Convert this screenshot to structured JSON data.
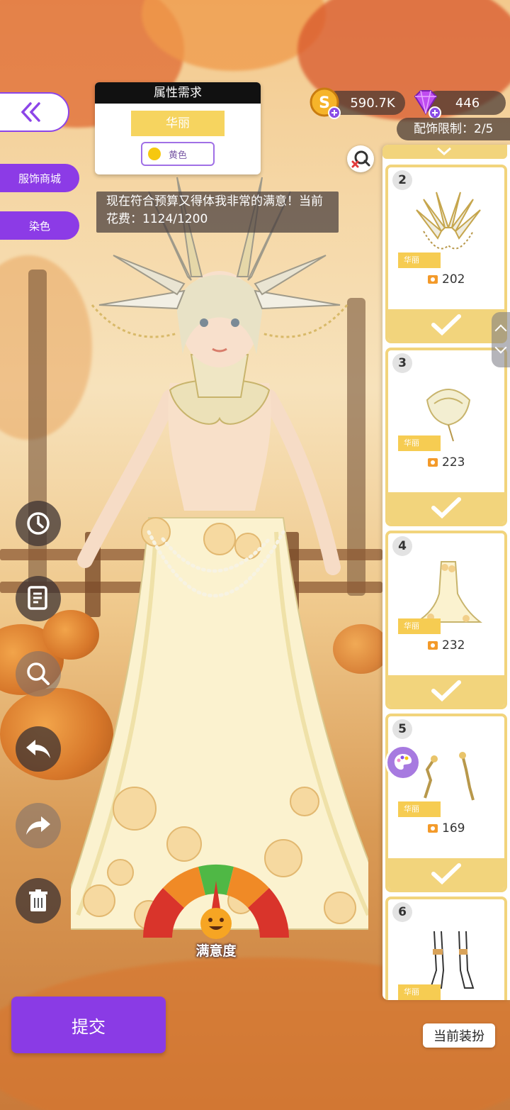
{
  "requirement": {
    "title": "属性需求",
    "style_tag": "华丽",
    "color_label": "黄色",
    "color_dot": "#f6c80f"
  },
  "comment": "现在符合预算又得体我非常的满意！当前花费：1124/1200",
  "side_menu": {
    "shop_label": "服饰商城",
    "dye_label": "染色"
  },
  "currency": {
    "gold": "590.7K",
    "gems": "446"
  },
  "accessory_limit": "配饰限制：2/5",
  "items": [
    {
      "number": "2",
      "tag": "华丽",
      "price": "202",
      "icon": "wing-headpiece-icon"
    },
    {
      "number": "3",
      "tag": "华丽",
      "price": "223",
      "icon": "necklace-icon"
    },
    {
      "number": "4",
      "tag": "华丽",
      "price": "232",
      "icon": "mermaid-skirt-icon"
    },
    {
      "number": "5",
      "tag": "华丽",
      "price": "169",
      "icon": "earrings-icon"
    },
    {
      "number": "6",
      "tag": "华丽",
      "price": "",
      "icon": "stockings-icon"
    }
  ],
  "satisfaction_label": "满意度",
  "submit_label": "提交",
  "current_outfit_label": "当前装扮",
  "colors": {
    "accent": "#8a3be5",
    "panel_gold": "#f2d47c",
    "tag_gold": "#f6cc52"
  }
}
